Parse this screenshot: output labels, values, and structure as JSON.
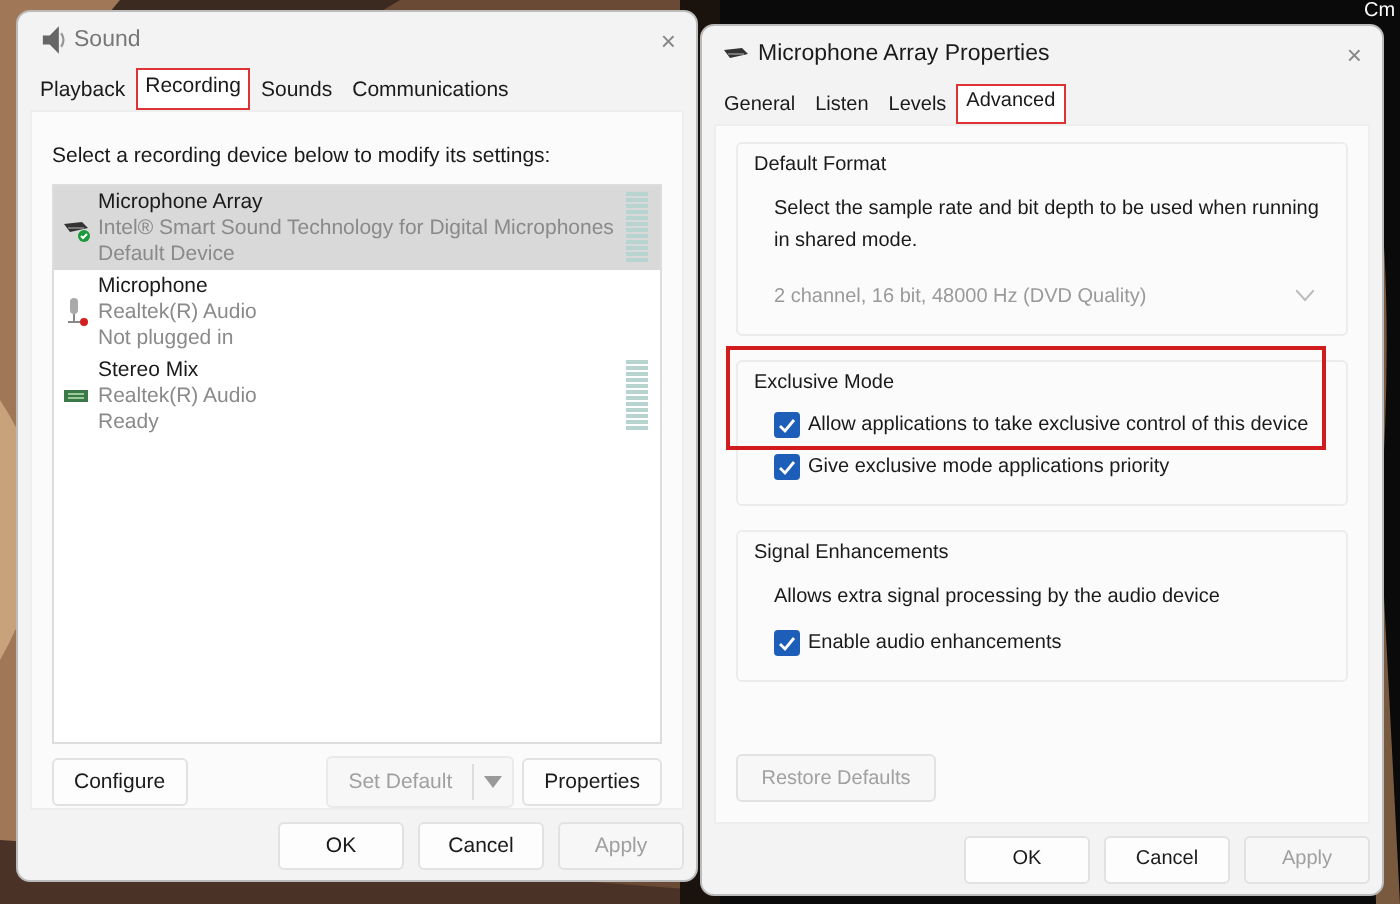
{
  "desktop": {
    "corner_text": "Cm"
  },
  "sound_window": {
    "title": "Sound",
    "close": "×",
    "tabs": [
      {
        "label": "Playback",
        "selected": false,
        "highlighted": false
      },
      {
        "label": "Recording",
        "selected": true,
        "highlighted": true
      },
      {
        "label": "Sounds",
        "selected": false,
        "highlighted": false
      },
      {
        "label": "Communications",
        "selected": false,
        "highlighted": false
      }
    ],
    "instruction": "Select a recording device below to modify its settings:",
    "devices": [
      {
        "kind": "array",
        "default": true,
        "unplugged": false,
        "name": "Microphone Array",
        "driver": "Intel® Smart Sound Technology for Digital Microphones",
        "status": "Default Device",
        "selected": true,
        "meter": true
      },
      {
        "kind": "microphone",
        "default": false,
        "unplugged": true,
        "name": "Microphone",
        "driver": "Realtek(R) Audio",
        "status": "Not plugged in",
        "selected": false,
        "meter": false
      },
      {
        "kind": "line",
        "default": false,
        "unplugged": false,
        "name": "Stereo Mix",
        "driver": "Realtek(R) Audio",
        "status": "Ready",
        "selected": false,
        "meter": true
      }
    ],
    "buttons": [
      {
        "kind": "plain",
        "label": "Configure",
        "disabled": false
      },
      {
        "kind": "split",
        "label": "Set Default",
        "disabled": true
      },
      {
        "kind": "plain",
        "label": "Properties",
        "disabled": false
      }
    ],
    "footer_buttons": [
      {
        "label": "OK",
        "disabled": false
      },
      {
        "label": "Cancel",
        "disabled": false
      },
      {
        "label": "Apply",
        "disabled": true
      }
    ]
  },
  "properties_window": {
    "title": "Microphone Array Properties",
    "close": "×",
    "tabs": [
      {
        "label": "General",
        "selected": false,
        "highlighted": false
      },
      {
        "label": "Listen",
        "selected": false,
        "highlighted": false
      },
      {
        "label": "Levels",
        "selected": false,
        "highlighted": false
      },
      {
        "label": "Advanced",
        "selected": true,
        "highlighted": true
      }
    ],
    "groups": [
      {
        "title": "Default Format",
        "description": "Select the sample rate and bit depth to be used when running in shared mode.",
        "dropdown": {
          "value": "2 channel, 16 bit, 48000 Hz (DVD Quality)",
          "disabled": true
        }
      },
      {
        "title": "Exclusive Mode",
        "highlighted": true,
        "options": [
          {
            "label": "Allow applications to take exclusive control of this device",
            "checked": true
          },
          {
            "label": "Give exclusive mode applications priority",
            "checked": true
          }
        ]
      },
      {
        "title": "Signal Enhancements",
        "description": "Allows extra signal processing by the audio device",
        "options": [
          {
            "label": "Enable audio enhancements",
            "checked": true
          }
        ]
      }
    ],
    "restore_button": {
      "label": "Restore Defaults",
      "disabled": true
    },
    "footer_buttons": [
      {
        "label": "OK",
        "disabled": false
      },
      {
        "label": "Cancel",
        "disabled": false
      },
      {
        "label": "Apply",
        "disabled": true
      }
    ]
  }
}
